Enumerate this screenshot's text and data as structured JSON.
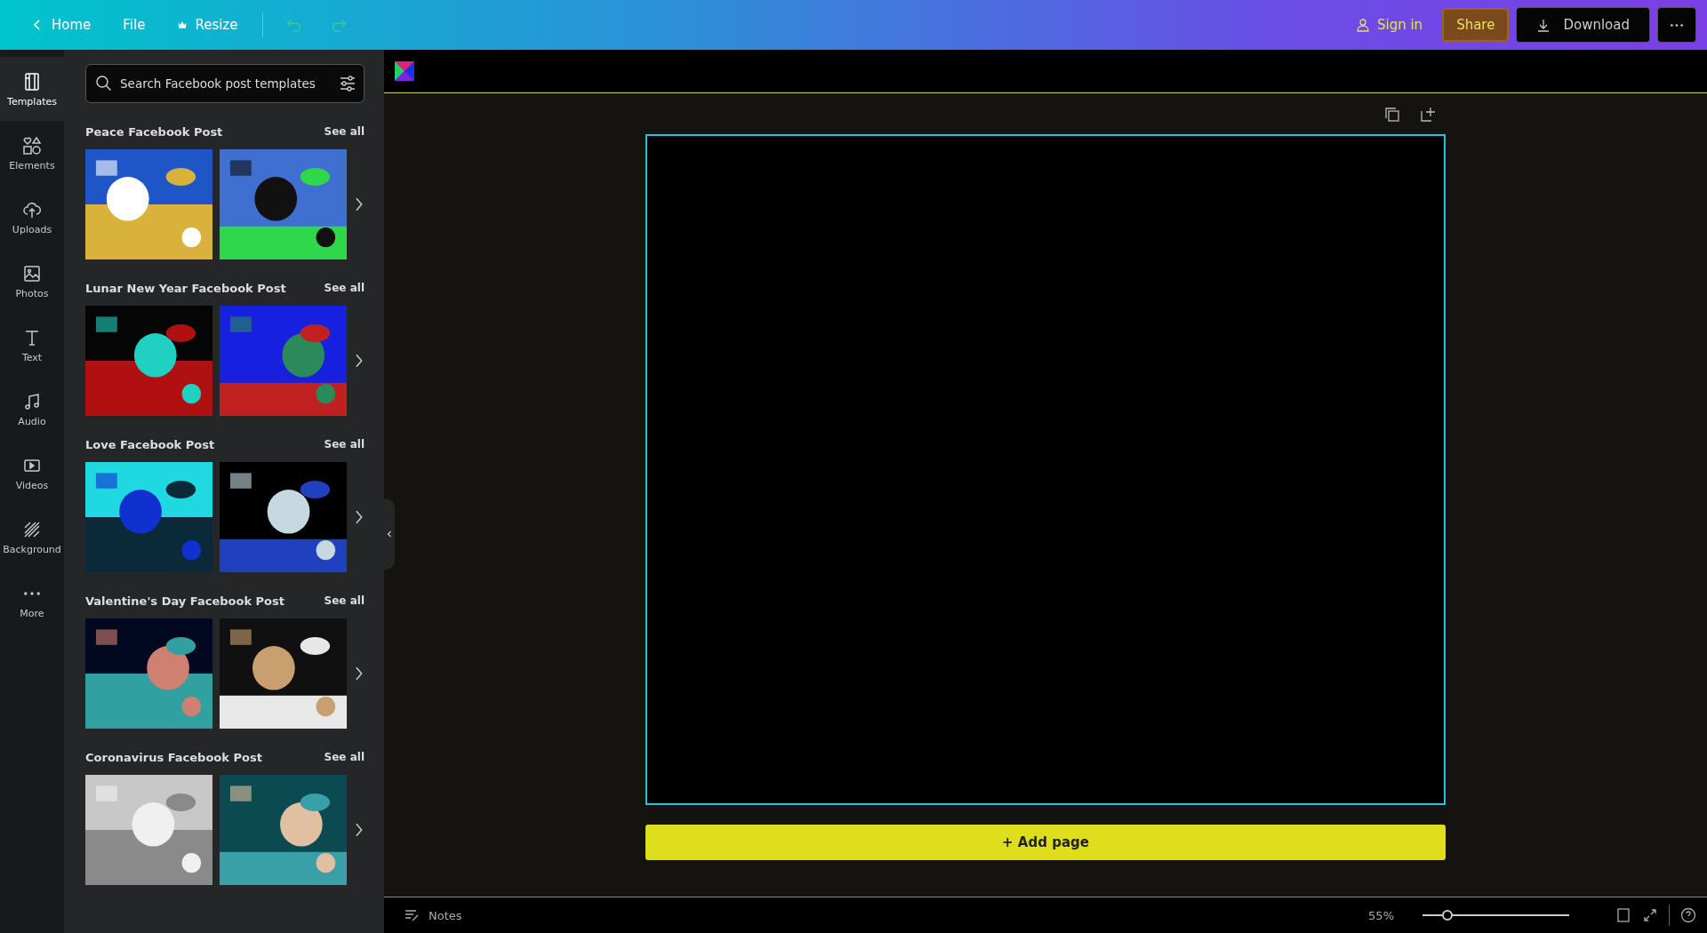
{
  "topbar": {
    "back": "Home",
    "menu": [
      "File",
      "Resize"
    ],
    "sign_in": "Sign in",
    "share": "Share",
    "download": "Download"
  },
  "rail": [
    {
      "label": "Templates",
      "selected": true
    },
    {
      "label": "Elements",
      "selected": false
    },
    {
      "label": "Uploads",
      "selected": false
    },
    {
      "label": "Photos",
      "selected": false
    },
    {
      "label": "Text",
      "selected": false
    },
    {
      "label": "Audio",
      "selected": false
    },
    {
      "label": "Videos",
      "selected": false
    },
    {
      "label": "Background",
      "selected": false
    },
    {
      "label": "More",
      "selected": false
    }
  ],
  "search": {
    "placeholder": "Search Facebook post templates"
  },
  "sections": [
    {
      "title": "Peace Facebook Post",
      "see_all": "See all"
    },
    {
      "title": "Lunar New Year Facebook Post",
      "see_all": "See all"
    },
    {
      "title": "Love Facebook Post",
      "see_all": "See all"
    },
    {
      "title": "Valentine's Day Facebook Post",
      "see_all": "See all"
    },
    {
      "title": "Coronavirus Facebook Post",
      "see_all": "See all"
    }
  ],
  "editor": {
    "add_page": "+ Add page"
  },
  "footer": {
    "notes": "Notes",
    "zoom": "55%",
    "zoom_slider": {
      "level": 0.17
    }
  }
}
